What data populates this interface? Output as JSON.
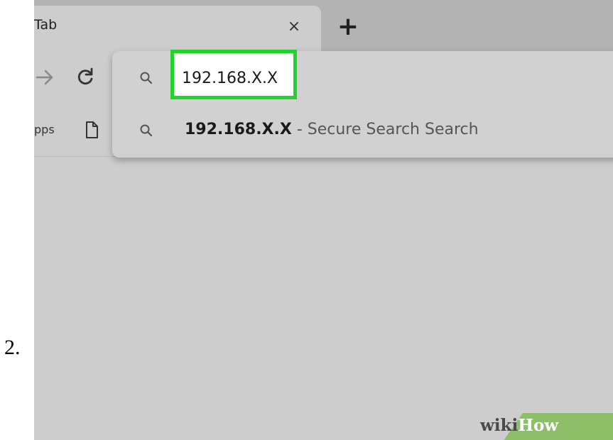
{
  "step": {
    "number": "2."
  },
  "browser": {
    "tab": {
      "title": "Tab",
      "close_glyph": "×"
    },
    "new_tab_glyph": "+",
    "toolbar": {
      "forward_icon": "arrow-right-icon",
      "reload_icon": "reload-icon"
    },
    "bookmarks_bar": {
      "apps_label": "pps",
      "page_icon": "page-icon"
    },
    "omnibox": {
      "value": "192.168.X.X",
      "highlight_color": "#20d42a",
      "suggestion": {
        "query": "192.168.X.X",
        "suffix": " - Secure Search Search"
      }
    }
  },
  "watermark": {
    "part1": "wiki",
    "part2": "How"
  },
  "colors": {
    "chrome_bg": "#cdcdcd",
    "tabstrip_bg": "#b3b3b3",
    "watermark_bg": "#8dbf68"
  }
}
